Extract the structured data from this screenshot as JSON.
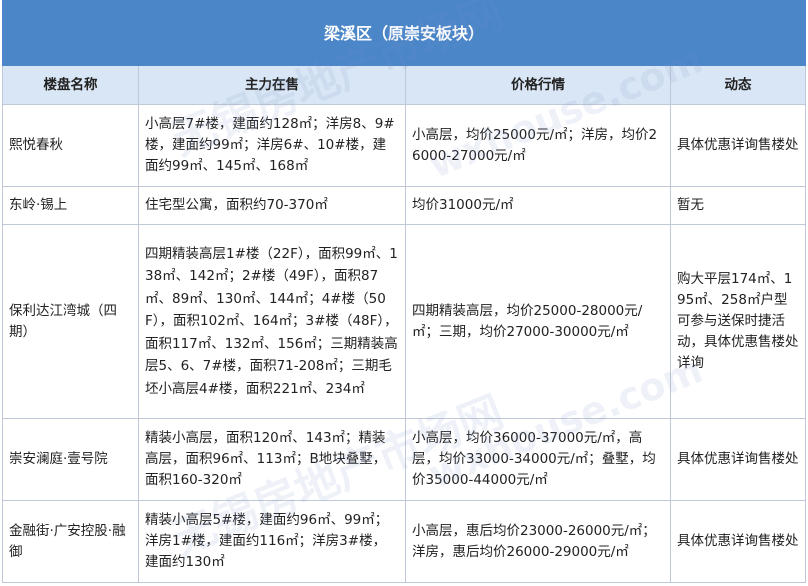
{
  "title": "梁溪区（原崇安板块）",
  "headers": [
    "楼盘名称",
    "主力在售",
    "价格行情",
    "动态"
  ],
  "rows": [
    {
      "name": "熙悦春秋",
      "supply": "小高层7#楼，建面约128㎡；洋房8、9#楼，建面约99㎡；洋房6#、10#楼，建面约99㎡、145㎡、168㎡",
      "price": "小高层，均价25000元/㎡；洋房，均价26000-27000元/㎡",
      "status": "具体优惠详询售楼处"
    },
    {
      "name": "东岭·锡上",
      "supply": "住宅型公寓，面积约70-370㎡",
      "price": "均价31000元/㎡",
      "status": "暂无"
    },
    {
      "name": "保利达江湾城（四期）",
      "supply": "四期精装高层1#楼（22F），面积99㎡、138㎡、142㎡；2#楼（49F），面积87㎡、89㎡、130㎡、144㎡；4#楼（50F），面积102㎡、164㎡；3#楼（48F），面积117㎡、132㎡、156㎡；三期精装高层5、6、7#楼，面积71-208㎡；三期毛坯小高层4#楼，面积221㎡、234㎡",
      "price": "四期精装高层，均价25000-28000元/㎡；三期，均价27000-30000元/㎡",
      "status": "购大平层174㎡、195㎡、258㎡户型可参与送保时捷活动，具体优惠售楼处详询"
    },
    {
      "name": "崇安澜庭·壹号院",
      "supply": "精装小高层，面积120㎡、143㎡；精装高层，面积96㎡、113㎡；B地块叠墅，面积160-320㎡",
      "price": "小高层，均价36000-37000元/㎡，高层，均价33000-34000元/㎡；叠墅，均价35000-44000元/㎡",
      "status": "具体优惠详询售楼处"
    },
    {
      "name": "金融街·广安控股·融御",
      "supply": "精装小高层5#楼，建面约96㎡、99㎡；洋房1#楼，建面约116㎡；洋房3#楼，建面约130㎡",
      "price": "小高层，惠后均价23000-26000元/㎡；洋房，惠后均价26000-29000元/㎡",
      "status": "具体优惠详询售楼处"
    }
  ],
  "watermark": [
    "无锡房地产市场网",
    "wxhouse.com"
  ]
}
